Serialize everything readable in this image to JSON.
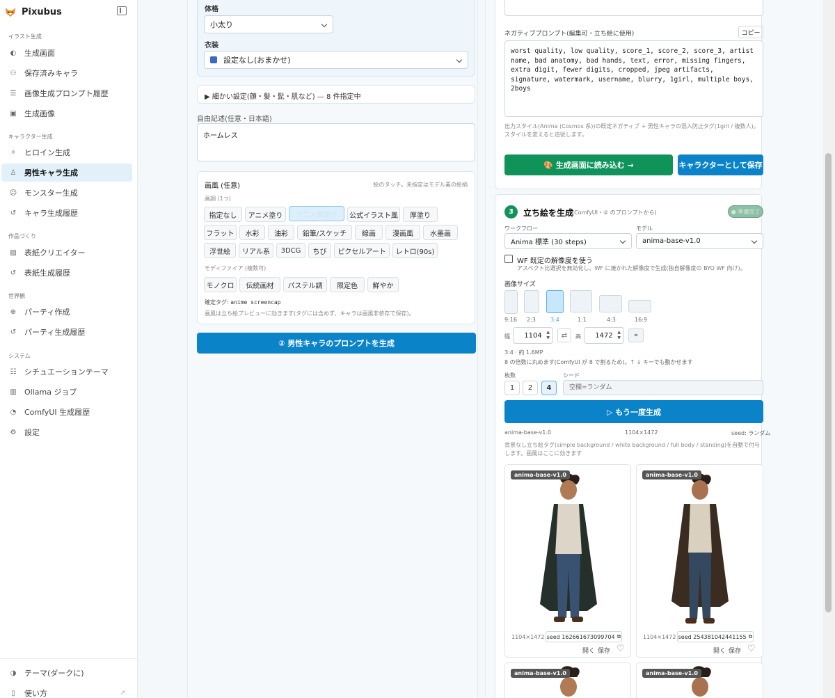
{
  "app": {
    "title": "Pixubus"
  },
  "sidebar": {
    "sections": {
      "illust": "イラスト生成",
      "chara": "キャラクター生成",
      "works": "作品づくり",
      "world": "世界観",
      "system": "システム"
    },
    "items": {
      "gen_screen": "生成画面",
      "saved_chars": "保存済みキャラ",
      "prompt_history": "画像生成プロンプト履歴",
      "gen_images": "生成画像",
      "heroine": "ヒロイン生成",
      "male": "男性キャラ生成",
      "monster": "モンスター生成",
      "char_history": "キャラ生成履歴",
      "cover_creator": "表紙クリエイター",
      "cover_history": "表紙生成履歴",
      "party_create": "パーティ作成",
      "party_history": "パーティ生成履歴",
      "situation": "シチュエーションテーマ",
      "ollama": "Ollama ジョブ",
      "comfy_history": "ComfyUI 生成履歴",
      "settings": "設定",
      "theme": "テーマ(ダークに)",
      "help": "使い方"
    }
  },
  "left": {
    "body_label": "体格",
    "body_value": "小太り",
    "costume_label": "衣装",
    "costume_value": "設定なし(おまかせ)",
    "detail_toggle": "▶ 細かい設定(顔・髪・髭・肌など) — 8 件指定中",
    "free_label": "自由記述(任意・日本語)",
    "free_value": "ホームレス",
    "style_title": "画風 (任意)",
    "style_hint": "絵のタッチ。未指定はモデル素の絵柄",
    "tone_label": "画調 (1つ)",
    "tones": [
      "指定なし",
      "アニメ塗り",
      "アニメ風塗り",
      "公式イラスト風",
      "厚塗り",
      "フラット",
      "水彩",
      "油彩",
      "鉛筆/スケッチ",
      "線画",
      "漫画風",
      "水墨画",
      "浮世絵",
      "リアル系",
      "3DCG",
      "ちび",
      "ピクセルアート",
      "レトロ(90s)"
    ],
    "modifier_label": "モディファイア (複数可)",
    "modifiers": [
      "モノクロ",
      "伝統画材",
      "パステル調",
      "限定色",
      "鮮やか"
    ],
    "fixed_tag_label": "確定タグ:",
    "fixed_tag_value": "anime screencap",
    "style_note": "画風は立ち絵プレビューに効きます(タグには含めず、キャラは画風非依存で保存)。",
    "generate_button": "② 男性キャラのプロンプトを生成"
  },
  "right": {
    "neg_label": "ネガティブプロンプト(編集可・立ち絵に使用)",
    "copy_button": "コピー",
    "neg_value": "worst quality, low quality, score_1, score_2, score_3, artist name, bad anatomy, bad hands, text, error, missing fingers, extra digit, fewer digits, cropped, jpeg artifacts, signature, watermark, username, blurry, 1girl, multiple boys, 2boys",
    "neg_note": "出力スタイル(Anima (Cosmos 系))の既定ネガティブ + 男性キャラの混入防止タグ(1girl / 複数人)。スタイルを変えると追従します。",
    "load_button": "🎨 生成画面に読み込む →",
    "save_button": "キャラクターとして保存",
    "step_num": "3",
    "step_title": "立ち絵を生成",
    "step_sub": "(ComfyUI・② のプロンプトから)",
    "ready_badge": "● 準備完了",
    "workflow_label": "ワークフロー",
    "workflow_value": "Anima 標準 (30 steps)",
    "model_label": "モデル",
    "model_value": "anima-base-v1.0",
    "wf_res_label": "WF 既定の解像度を使う",
    "wf_res_note": "アスペクト比選択を無効化し、WF に焼かれた解像度で生成(独自解像度の BYO WF 向け)。",
    "size_label": "画像サイズ",
    "ratios": [
      "9:16",
      "2:3",
      "3:4",
      "1:1",
      "4:3",
      "16:9"
    ],
    "width_label": "幅",
    "width_value": "1104",
    "height_label": "高",
    "height_value": "1472",
    "ratio_info": "3:4 · 約 1.6MP",
    "round_note": "8 の倍数に丸めます(ComfyUI が 8 で割るため)。↑ ↓ キーでも動かせます",
    "count_label": "枚数",
    "counts": [
      "1",
      "2",
      "4"
    ],
    "seed_label": "シード",
    "seed_placeholder": "空欄=ランダム",
    "regen_button": "▷ もう一度生成",
    "meta_model": "anima-base-v1.0",
    "meta_size": "1104×1472",
    "meta_seed": "seed: ランダム",
    "bg_note": "背景なし立ち絵タグ(simple background / white background / full body / standing)を自動で付与します。画風はここに効きます",
    "images": [
      {
        "badge": "anima-base-v1.0",
        "size": "1104×1472",
        "seed": "seed 162661673099704",
        "open": "開く",
        "save": "保存"
      },
      {
        "badge": "anima-base-v1.0",
        "size": "1104×1472",
        "seed": "seed 254381042441155",
        "open": "開く",
        "save": "保存"
      },
      {
        "badge": "anima-base-v1.0"
      },
      {
        "badge": "anima-base-v1.0"
      }
    ]
  }
}
